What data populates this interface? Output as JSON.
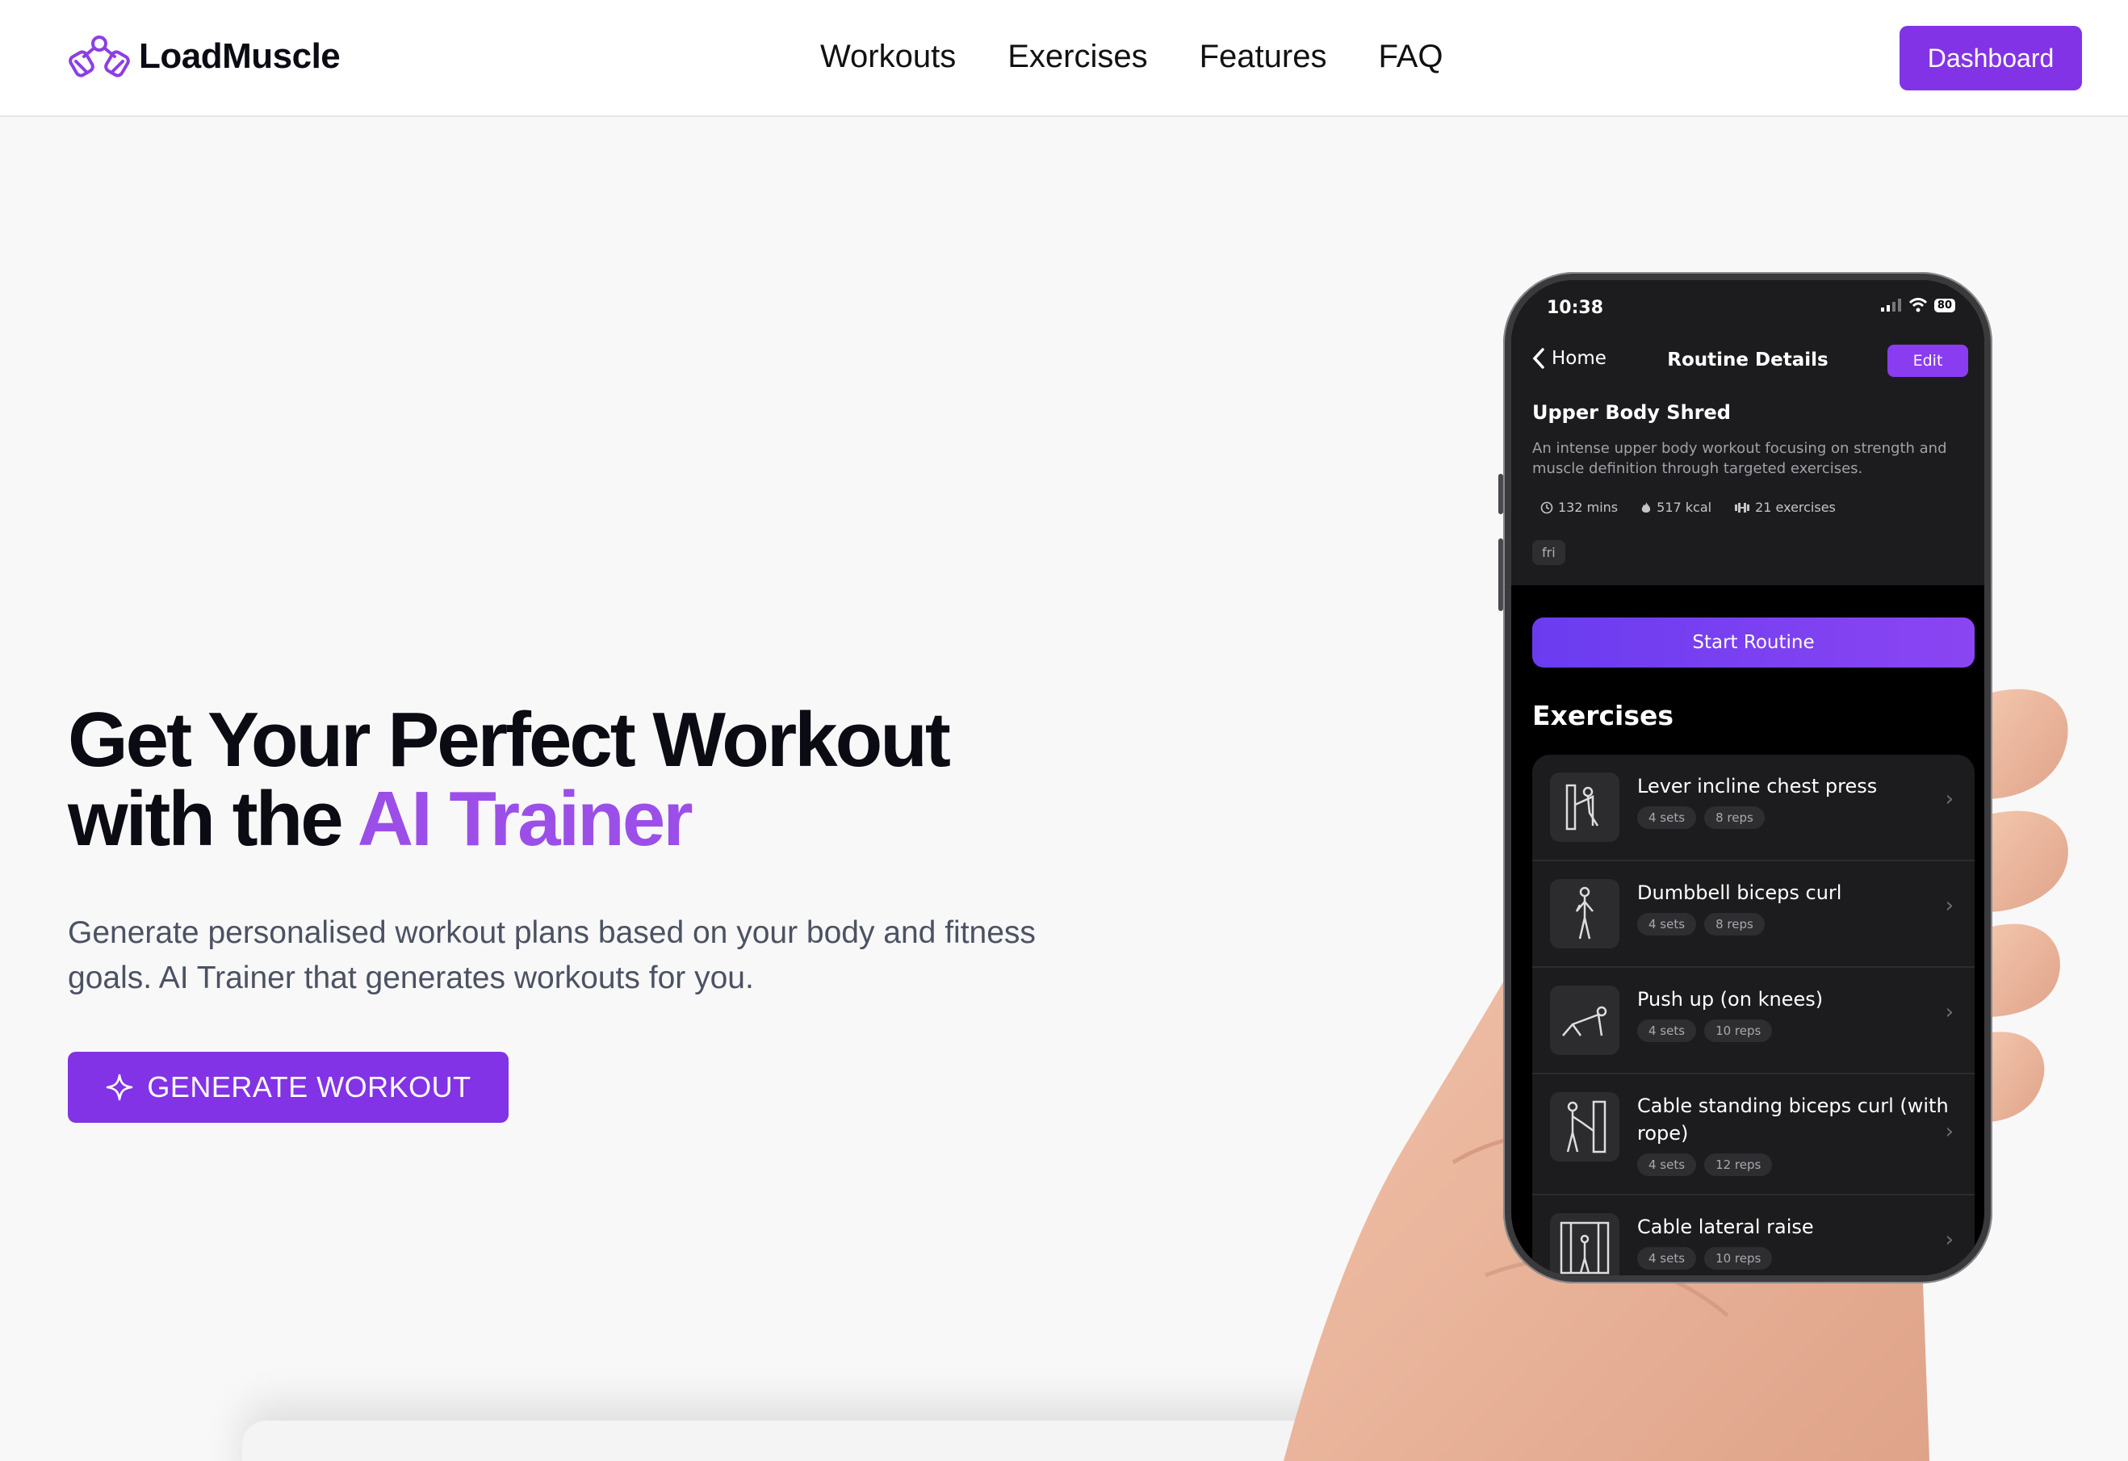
{
  "brand": {
    "name": "LoadMuscle",
    "accent": "#8233e6",
    "accent_light": "#9b4fe8"
  },
  "nav": {
    "items": [
      {
        "label": "Workouts"
      },
      {
        "label": "Exercises"
      },
      {
        "label": "Features"
      },
      {
        "label": "FAQ"
      }
    ]
  },
  "header": {
    "dashboard_label": "Dashboard"
  },
  "hero": {
    "title_line1": "Get Your Perfect Workout",
    "title_line2_prefix": "with the ",
    "title_line2_accent": "AI Trainer",
    "subtitle": "Generate personalised workout plans based on your body and fitness goals. AI Trainer that generates workouts for you.",
    "cta_label": "GENERATE WORKOUT",
    "cta_icon": "sparkle-icon"
  },
  "phone": {
    "status_time": "10:38",
    "battery": "80",
    "back_label": "Home",
    "screen_title": "Routine Details",
    "edit_label": "Edit",
    "routine_name": "Upper Body Shred",
    "routine_desc": "An intense upper body workout focusing on strength and muscle definition through targeted exercises.",
    "stats": {
      "duration": "132 mins",
      "calories": "517 kcal",
      "exercises": "21 exercises"
    },
    "day_tag": "fri",
    "start_label": "Start Routine",
    "exercises_heading": "Exercises",
    "exercises": [
      {
        "name": "Lever incline chest press",
        "sets": "4 sets",
        "reps": "8 reps"
      },
      {
        "name": "Dumbbell biceps curl",
        "sets": "4 sets",
        "reps": "8 reps"
      },
      {
        "name": "Push up (on knees)",
        "sets": "4 sets",
        "reps": "10 reps"
      },
      {
        "name": "Cable standing biceps curl (with rope)",
        "sets": "4 sets",
        "reps": "12 reps"
      },
      {
        "name": "Cable lateral raise",
        "sets": "4 sets",
        "reps": "10 reps"
      }
    ]
  }
}
